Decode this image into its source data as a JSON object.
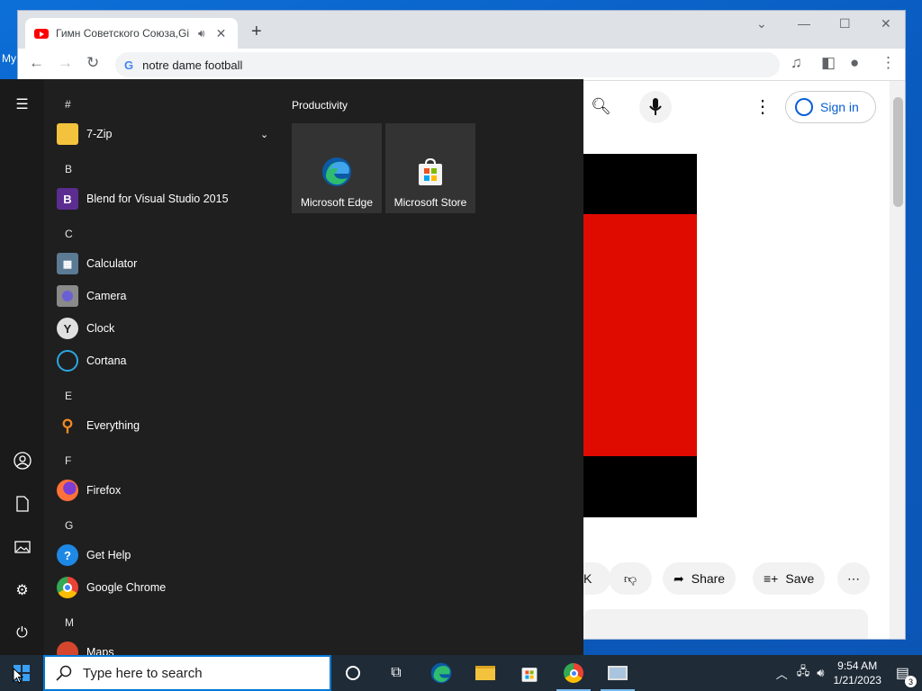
{
  "desktop": {
    "label": "My"
  },
  "browser": {
    "tab": {
      "title": "Гимн Советского Союза,Gi",
      "audio_icon": "speaker-icon",
      "close_icon": "close-icon"
    },
    "omnibox": {
      "text": "notre dame football"
    },
    "youtube": {
      "sign_in": "Sign in",
      "like_fragment": "K",
      "share": "Share",
      "save": "Save"
    }
  },
  "start_menu": {
    "sections": [
      {
        "letter": "#",
        "apps": [
          {
            "label": "7-Zip",
            "icon": "folder-icon"
          }
        ]
      },
      {
        "letter": "B",
        "apps": [
          {
            "label": "Blend for Visual Studio 2015",
            "icon": "blend-icon"
          }
        ]
      },
      {
        "letter": "C",
        "apps": [
          {
            "label": "Calculator",
            "icon": "calculator-icon"
          },
          {
            "label": "Camera",
            "icon": "camera-icon"
          },
          {
            "label": "Clock",
            "icon": "clock-icon"
          },
          {
            "label": "Cortana",
            "icon": "cortana-icon"
          }
        ]
      },
      {
        "letter": "E",
        "apps": [
          {
            "label": "Everything",
            "icon": "search-magnifier-icon"
          }
        ]
      },
      {
        "letter": "F",
        "apps": [
          {
            "label": "Firefox",
            "icon": "firefox-icon"
          }
        ]
      },
      {
        "letter": "G",
        "apps": [
          {
            "label": "Get Help",
            "icon": "help-icon"
          },
          {
            "label": "Google Chrome",
            "icon": "chrome-icon"
          }
        ]
      },
      {
        "letter": "M",
        "apps": [
          {
            "label": "Maps",
            "icon": "maps-icon"
          }
        ]
      }
    ],
    "tiles_group": "Productivity",
    "tiles": [
      {
        "label": "Microsoft Edge",
        "icon": "edge-icon"
      },
      {
        "label": "Microsoft Store",
        "icon": "store-icon"
      }
    ]
  },
  "taskbar": {
    "search_placeholder": "Type here to search",
    "clock": {
      "time": "9:54 AM",
      "date": "1/21/2023"
    },
    "notification_count": "3"
  }
}
